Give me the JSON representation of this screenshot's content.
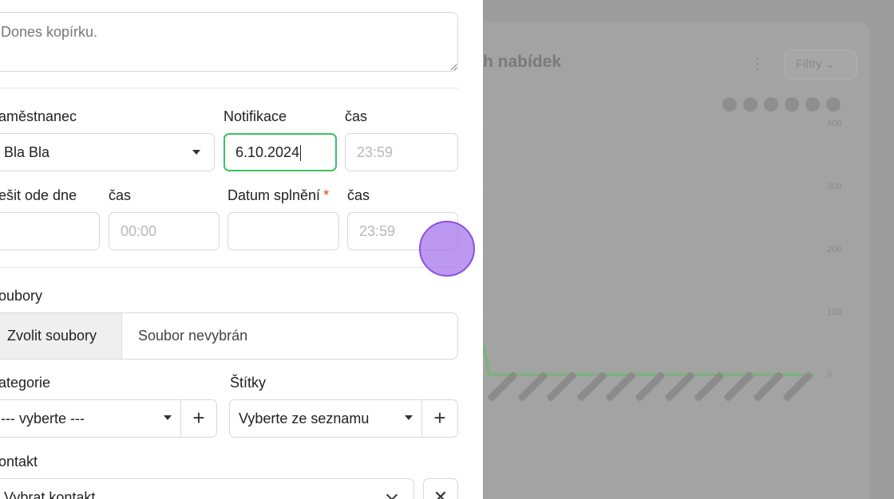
{
  "background": {
    "title": "h nabídek",
    "filter_label": "Filtry ⌄",
    "more_icon": "⋮",
    "y_ticks": [
      "400",
      "300",
      "200",
      "100",
      "0"
    ],
    "colors": {
      "overlay": "#9a9a9a",
      "line": "#7fb07f"
    }
  },
  "form": {
    "note": {
      "value": "",
      "placeholder": "Dones kopírku."
    },
    "zamestnanec": {
      "label": "aměstnanec",
      "value": "Bla Bla"
    },
    "notifikace": {
      "label": "Notifikace",
      "value": "6.10.2024"
    },
    "notifikace_cas": {
      "label": "čas",
      "placeholder": "23:59"
    },
    "resit_od": {
      "label": "ešit ode dne",
      "value": ""
    },
    "resit_od_cas": {
      "label": "čas",
      "placeholder": "00:00"
    },
    "datum_splneni": {
      "label": "Datum splnění",
      "required": "*",
      "value": ""
    },
    "datum_splneni_cas": {
      "label": "čas",
      "placeholder": "23:59"
    },
    "soubory": {
      "label": "oubory",
      "button": "Zvolit soubory",
      "status": "Soubor nevybrán"
    },
    "kategorie": {
      "label": "ategorie",
      "value": "--- vyberte ---",
      "add": "+"
    },
    "stitky": {
      "label": "Štítky",
      "value": "Vyberte ze seznamu",
      "add": "+"
    },
    "kontakt": {
      "label": "ontakt",
      "value": "Vybrat kontakt",
      "clear": "✕"
    }
  },
  "colors": {
    "focus_border": "#3fbf5f",
    "required": "#d9480f",
    "cursor": "#a470ec"
  }
}
